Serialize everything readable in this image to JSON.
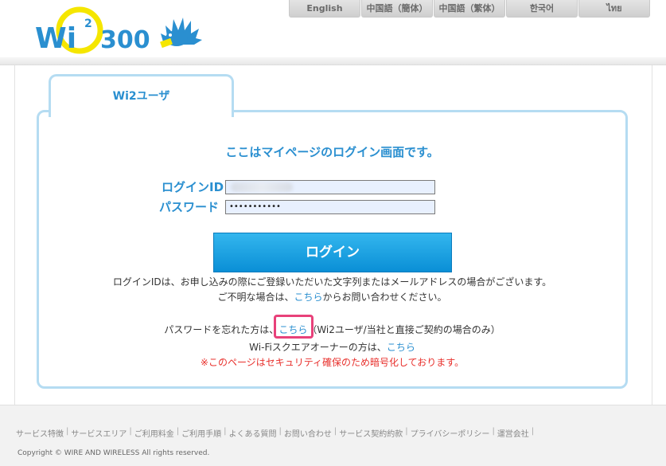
{
  "header": {
    "languages": [
      "English",
      "中国語（簡体）",
      "中国語（繁体）",
      "한국어",
      "ไทย"
    ]
  },
  "tab": {
    "label": "Wi2ユーザ"
  },
  "login": {
    "title": "ここはマイページのログイン画面です。",
    "id_label": "ログインID",
    "password_label": "パスワード",
    "password_mask": "•••••••••••",
    "button_label": "ログイン"
  },
  "notes": {
    "line1": "ログインIDは、お申し込みの際にご登録いただいた文字列またはメールアドレスの場合がございます。",
    "line2_pre": "ご不明な場合は、",
    "line2_link": "こちら",
    "line2_post": "からお問い合わせください。",
    "line3_pre": "パスワードを忘れた方は、",
    "line3_link": "こちら",
    "line3_post": "（Wi2ユーザ/当社と直接ご契約の場合のみ）",
    "line4_pre": "Wi-Fiスクエアオーナーの方は、",
    "line4_link": "こちら",
    "line5": "※このページはセキュリティ確保のため暗号化しております。"
  },
  "footer": {
    "links": [
      "サービス特徴",
      "サービスエリア",
      "ご利用料金",
      "ご利用手順",
      "よくある質問",
      "お問い合わせ",
      "サービス契約約款",
      "プライバシーポリシー",
      "運営会社"
    ],
    "copyright": "Copyright © WIRE AND WIRELESS All rights reserved."
  },
  "colors": {
    "accent": "#2a8fd0",
    "tab_border": "#b5dcf2",
    "warning": "#e8302c",
    "highlight": "#e8417a"
  }
}
